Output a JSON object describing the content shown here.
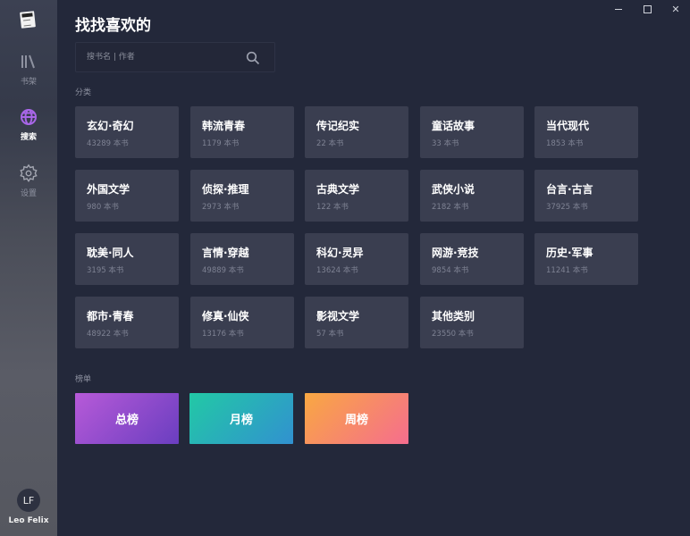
{
  "window": {
    "controls": {
      "minimize": "",
      "maximize": "",
      "close": "✕"
    }
  },
  "sidebar": {
    "items": [
      {
        "id": "shelf",
        "label": "书架",
        "icon": "bookshelf-icon"
      },
      {
        "id": "search",
        "label": "搜索",
        "icon": "globe-search-icon",
        "active": true
      },
      {
        "id": "settings",
        "label": "设置",
        "icon": "gear-icon"
      }
    ],
    "user": {
      "initials": "LF",
      "name": "Leo Felix"
    }
  },
  "main": {
    "title": "找找喜欢的",
    "search": {
      "placeholder": "搜书名 | 作者",
      "value": ""
    },
    "categories_label": "分类",
    "categories": [
      {
        "name": "玄幻·奇幻",
        "count": "43289 本书"
      },
      {
        "name": "韩流青春",
        "count": "1179 本书"
      },
      {
        "name": "传记纪实",
        "count": "22 本书"
      },
      {
        "name": "童话故事",
        "count": "33 本书"
      },
      {
        "name": "当代现代",
        "count": "1853 本书"
      },
      {
        "name": "外国文学",
        "count": "980 本书"
      },
      {
        "name": "侦探·推理",
        "count": "2973 本书"
      },
      {
        "name": "古典文学",
        "count": "122 本书"
      },
      {
        "name": "武侠小说",
        "count": "2182 本书"
      },
      {
        "name": "台言·古言",
        "count": "37925 本书"
      },
      {
        "name": "耽美·同人",
        "count": "3195 本书"
      },
      {
        "name": "言情·穿越",
        "count": "49889 本书"
      },
      {
        "name": "科幻·灵异",
        "count": "13624 本书"
      },
      {
        "name": "网游·竞技",
        "count": "9854 本书"
      },
      {
        "name": "历史·军事",
        "count": "11241 本书"
      },
      {
        "name": "都市·青春",
        "count": "48922 本书"
      },
      {
        "name": "修真·仙侠",
        "count": "13176 本书"
      },
      {
        "name": "影视文学",
        "count": "57 本书"
      },
      {
        "name": "其他类别",
        "count": "23550 本书"
      }
    ],
    "rankings_label": "榜单",
    "rankings": [
      {
        "label": "总榜",
        "colors": [
          "#b75ad8",
          "#6a3ec0"
        ]
      },
      {
        "label": "月榜",
        "colors": [
          "#22c9a5",
          "#3191d0"
        ]
      },
      {
        "label": "周榜",
        "colors": [
          "#f9a842",
          "#f56d8e"
        ]
      }
    ]
  }
}
